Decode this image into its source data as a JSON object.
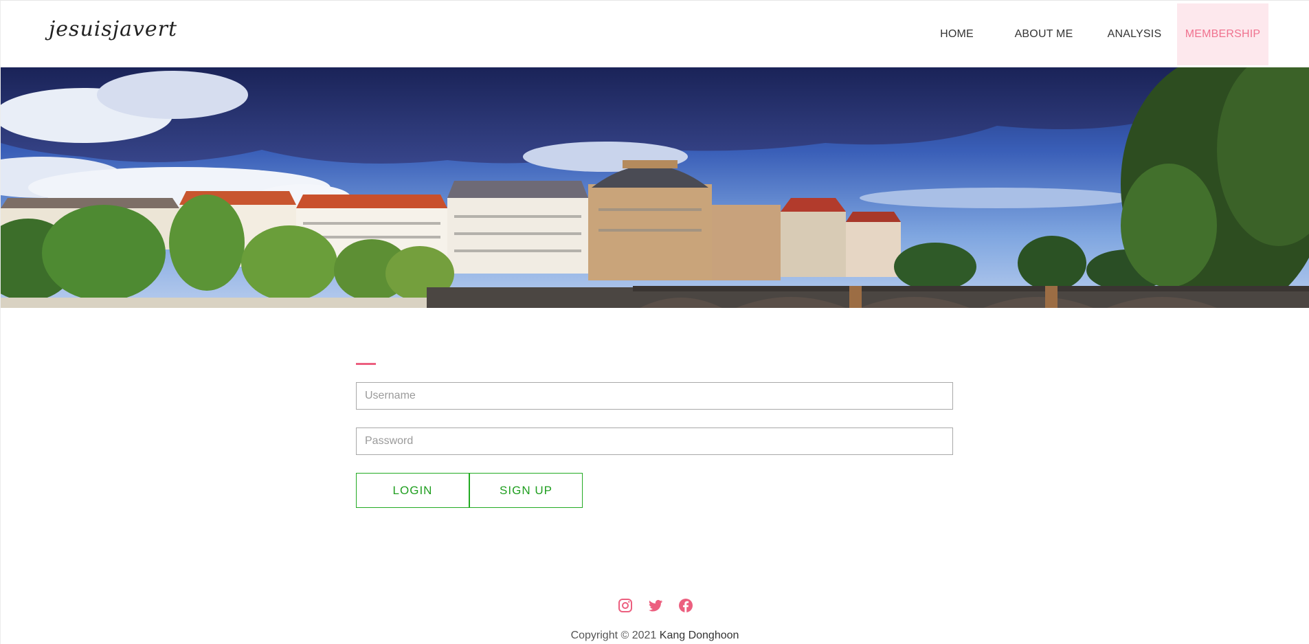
{
  "brand": {
    "logo_text": "jesuisjavert"
  },
  "nav": {
    "items": [
      {
        "label": "HOME"
      },
      {
        "label": "ABOUT ME"
      },
      {
        "label": "ANALYSIS"
      },
      {
        "label": "MEMBERSHIP",
        "active": true
      }
    ]
  },
  "colors": {
    "accent_pink": "#ec5f7f",
    "nav_active_bg": "#fde8ed",
    "nav_active_text": "#f0728f",
    "button_green": "#22aa22"
  },
  "hero": {
    "image_description_icon": "cityscape-banner"
  },
  "form": {
    "username_placeholder": "Username",
    "password_placeholder": "Password",
    "login_label": "LOGIN",
    "signup_label": "SIGN UP"
  },
  "footer": {
    "social_icons": [
      "instagram-icon",
      "twitter-icon",
      "facebook-icon"
    ],
    "copyright_prefix": "Copyright © 2021",
    "copyright_author": "Kang Donghoon"
  }
}
